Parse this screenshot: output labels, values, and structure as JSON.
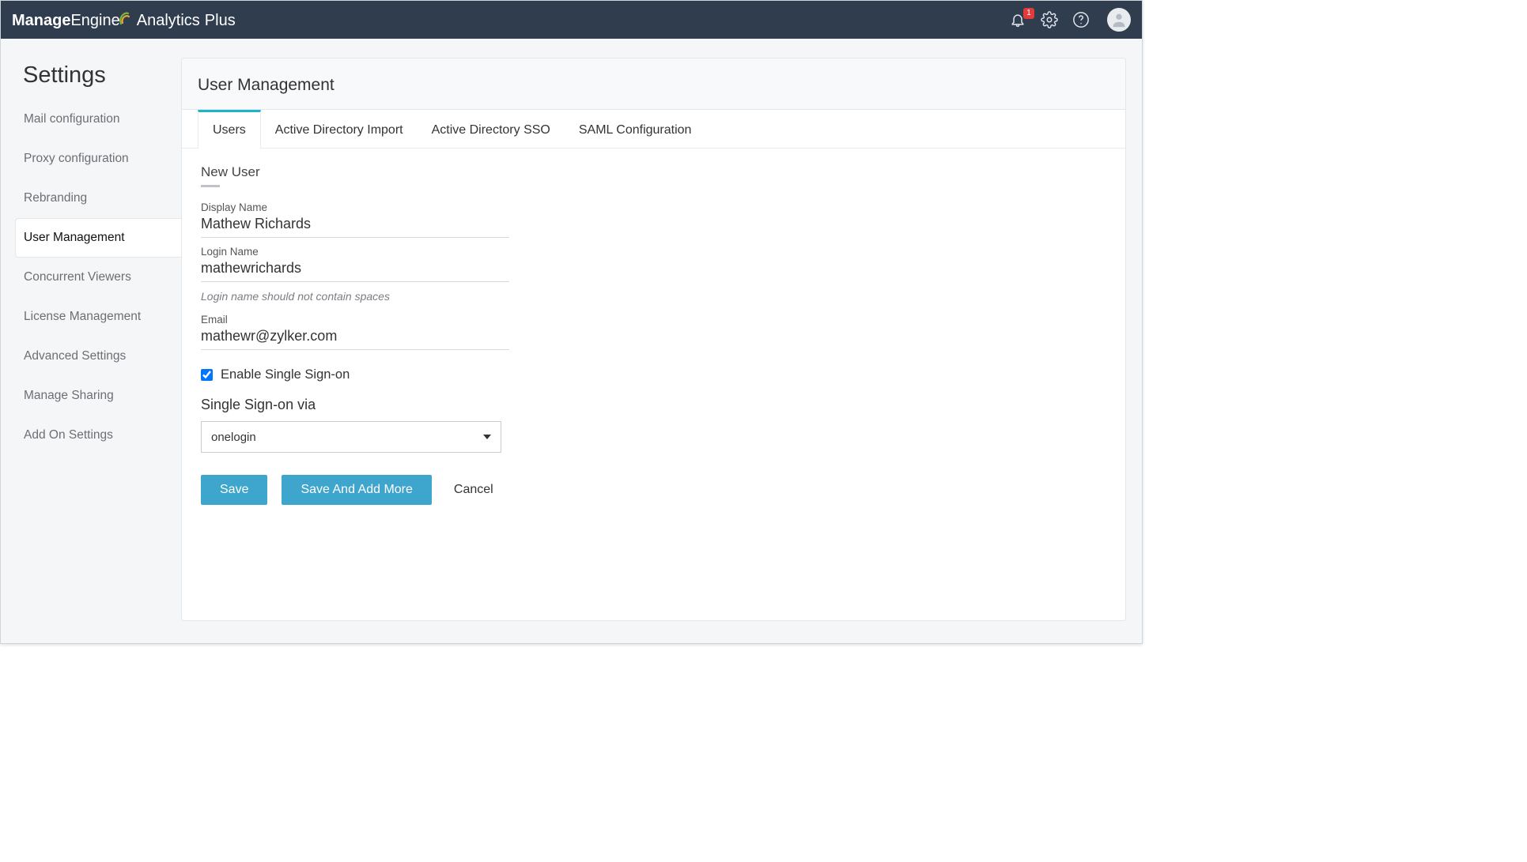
{
  "brand": {
    "part1": "ManageEngine",
    "part2": "Analytics",
    "part3": "Plus"
  },
  "notifications": {
    "count": "1"
  },
  "sidebar": {
    "title": "Settings",
    "items": [
      {
        "label": "Mail configuration"
      },
      {
        "label": "Proxy configuration"
      },
      {
        "label": "Rebranding"
      },
      {
        "label": "User Management"
      },
      {
        "label": "Concurrent Viewers"
      },
      {
        "label": "License Management"
      },
      {
        "label": "Advanced Settings"
      },
      {
        "label": "Manage Sharing"
      },
      {
        "label": "Add On Settings"
      }
    ],
    "activeIndex": 3
  },
  "page": {
    "title": "User Management",
    "tabs": [
      {
        "label": "Users"
      },
      {
        "label": "Active Directory Import"
      },
      {
        "label": "Active Directory SSO"
      },
      {
        "label": "SAML Configuration"
      }
    ],
    "activeTab": 0
  },
  "form": {
    "sectionTitle": "New User",
    "displayName": {
      "label": "Display Name",
      "value": "Mathew Richards"
    },
    "loginName": {
      "label": "Login Name",
      "value": "mathewrichards",
      "hint": "Login name should not contain spaces"
    },
    "email": {
      "label": "Email",
      "value": "mathewr@zylker.com"
    },
    "ssoCheckbox": {
      "label": "Enable Single Sign-on",
      "checked": true
    },
    "ssoVia": {
      "label": "Single Sign-on via",
      "selected": "onelogin"
    },
    "buttons": {
      "save": "Save",
      "saveAddMore": "Save And Add More",
      "cancel": "Cancel"
    }
  }
}
